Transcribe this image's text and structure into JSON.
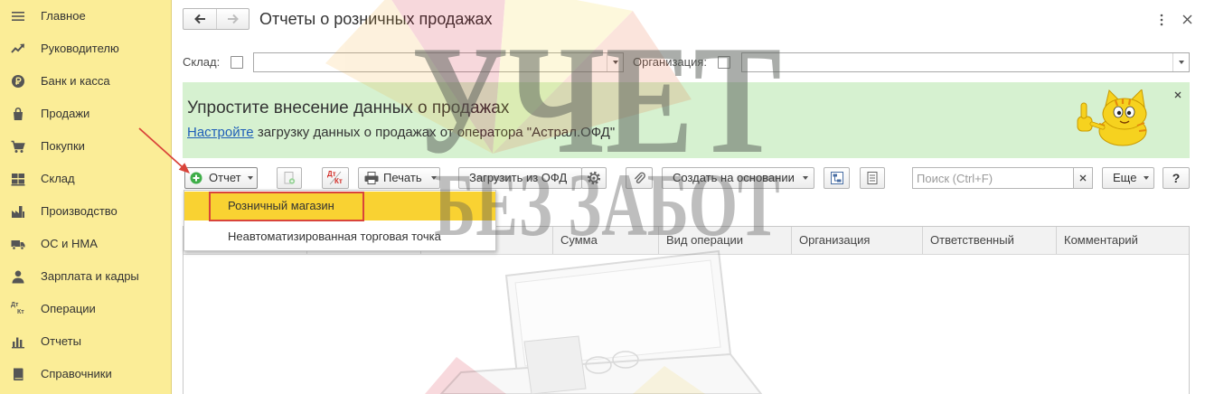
{
  "window": {
    "title": "Отчеты о розничных продажах"
  },
  "sidebar": {
    "items": [
      {
        "label": "Главное",
        "icon": "menu-icon"
      },
      {
        "label": "Руководителю",
        "icon": "trend-up-icon"
      },
      {
        "label": "Банк и касса",
        "icon": "ruble-coin-icon"
      },
      {
        "label": "Продажи",
        "icon": "shopping-bag-icon"
      },
      {
        "label": "Покупки",
        "icon": "cart-icon"
      },
      {
        "label": "Склад",
        "icon": "warehouse-icon"
      },
      {
        "label": "Производство",
        "icon": "factory-icon"
      },
      {
        "label": "ОС и НМА",
        "icon": "truck-icon"
      },
      {
        "label": "Зарплата и кадры",
        "icon": "person-icon"
      },
      {
        "label": "Операции",
        "icon": "debit-credit-icon"
      },
      {
        "label": "Отчеты",
        "icon": "bar-chart-icon"
      },
      {
        "label": "Справочники",
        "icon": "book-icon"
      }
    ]
  },
  "icons": {
    "debit": "Дт",
    "credit": "Кт"
  },
  "filters": {
    "warehouse_label": "Склад:",
    "warehouse_value": "",
    "warehouse_checked": false,
    "organization_label": "Организация:",
    "organization_value": "",
    "organization_checked": false
  },
  "banner": {
    "title": "Упростите внесение данных о продажах",
    "link_text": "Настройте",
    "text": " загрузку данных о продажах от оператора \"Астрал.ОФД\""
  },
  "toolbar": {
    "report_label": "Отчет",
    "print_label": "Печать",
    "load_ofd_label": "Загрузить из ОФД",
    "create_based_label": "Создать на основании",
    "search_placeholder": "Поиск (Ctrl+F)",
    "more_label": "Еще",
    "help_label": "?"
  },
  "report_menu": {
    "items": [
      {
        "label": "Розничный магазин",
        "highlighted": true
      },
      {
        "label": "Неавтоматизированная торговая точка",
        "highlighted": false
      }
    ]
  },
  "table": {
    "columns": [
      "Сумма",
      "Вид операции",
      "Организация",
      "Ответственный",
      "Комментарий"
    ],
    "rows": []
  },
  "watermark": {
    "line1": "УЧЕТ",
    "line2": "БЕЗ ЗАБОТ"
  },
  "colors": {
    "sidebar_bg": "#fbed97",
    "banner_bg": "#d6f1d0",
    "menu_highlight": "#f9d232",
    "link": "#1f5fb8",
    "annotation": "#d9443a",
    "add_icon": "#3fae49"
  }
}
